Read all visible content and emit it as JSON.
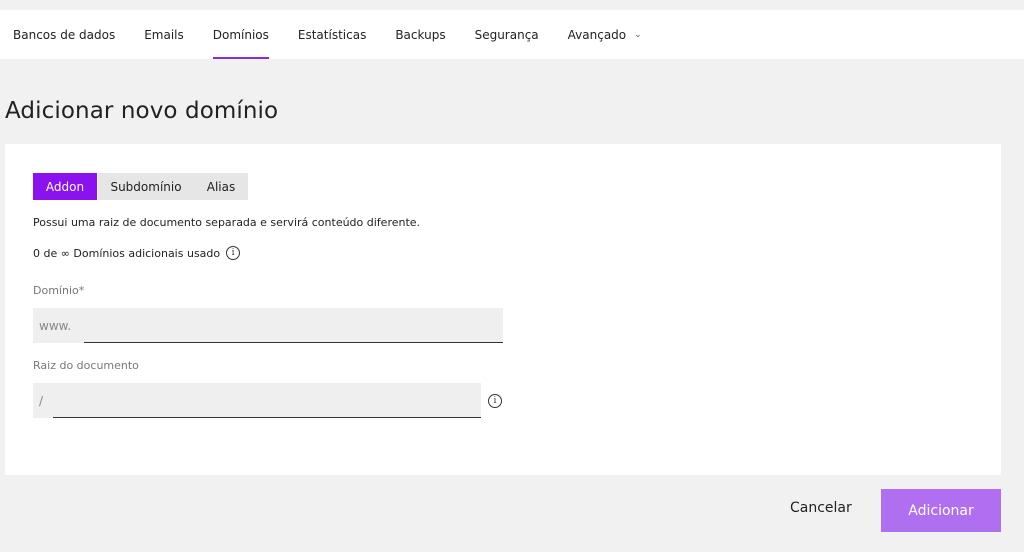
{
  "nav": {
    "items": [
      {
        "label": "Bancos de dados"
      },
      {
        "label": "Emails"
      },
      {
        "label": "Domínios"
      },
      {
        "label": "Estatísticas"
      },
      {
        "label": "Backups"
      },
      {
        "label": "Segurança"
      },
      {
        "label": "Avançado"
      }
    ],
    "active": "Domínios",
    "dropdown_icon": "chevron-down-icon"
  },
  "page": {
    "title": "Adicionar novo domínio"
  },
  "tabs": {
    "items": [
      {
        "label": "Addon"
      },
      {
        "label": "Subdomínio"
      },
      {
        "label": "Alias"
      }
    ],
    "active": "Addon"
  },
  "description": "Possui uma raiz de documento separada e servirá conteúdo diferente.",
  "usage": {
    "text": "0 de ∞ Domínios adicionais usado",
    "info_icon": "info-icon"
  },
  "domain_field": {
    "label": "Domínio*",
    "prefix": "www.",
    "value": ""
  },
  "docroot_field": {
    "label": "Raiz do documento",
    "prefix": "/",
    "value": ""
  },
  "actions": {
    "cancel_label": "Cancelar",
    "add_label": "Adicionar"
  },
  "colors": {
    "accent": "#8a12ee",
    "button_disabled": "#b06ef0",
    "background": "#f1f1f1"
  }
}
